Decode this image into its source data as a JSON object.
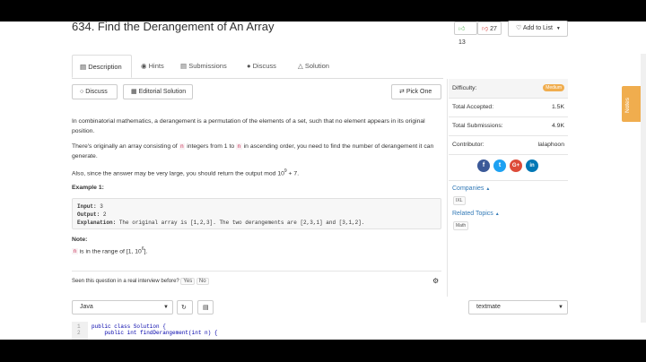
{
  "header": {
    "title": "634. Find the Derangement of An Array",
    "upvotes": "13",
    "downvotes": "27",
    "add_to_list": "Add to List"
  },
  "tabs": [
    {
      "label": "Description"
    },
    {
      "label": "Hints"
    },
    {
      "label": "Submissions"
    },
    {
      "label": "Discuss"
    },
    {
      "label": "Solution"
    }
  ],
  "actions": {
    "discuss": "Discuss",
    "editorial": "Editorial Solution",
    "pick_one": "Pick One"
  },
  "description": {
    "p1": "In combinatorial mathematics, a derangement is a permutation of the elements of a set, such that no element appears in its original position.",
    "p2_a": "There's originally an array consisting of",
    "p2_n1": "n",
    "p2_b": "integers from 1 to",
    "p2_n2": "n",
    "p2_c": "in ascending order, you need to find the number of derangement it can generate.",
    "p3_a": "Also, since the answer may be very large, you should return the output mod 10",
    "p3_exp": "9",
    "p3_b": " + 7.",
    "example_title": "Example 1:",
    "example_input_label": "Input:",
    "example_input": " 3",
    "example_output_label": "Output:",
    "example_output": " 2",
    "example_expl_label": "Explanation:",
    "example_expl": " The original array is [1,2,3]. The two derangements are [2,3,1] and [3,1,2].",
    "note_title": "Note:",
    "note_n": "n",
    "note_text_a": "is in the range of [1, 10",
    "note_exp": "6",
    "note_text_b": "]."
  },
  "interview": {
    "question": "Seen this question in a real interview before?",
    "yes": "Yes",
    "no": "No"
  },
  "sidebar": {
    "difficulty_label": "Difficulty:",
    "difficulty_value": "Medium",
    "accepted_label": "Total Accepted:",
    "accepted_value": "1.5K",
    "submissions_label": "Total Submissions:",
    "submissions_value": "4.9K",
    "contributor_label": "Contributor:",
    "contributor_value": "lalaphoon",
    "companies_label": "Companies",
    "companies_tag": "IXL",
    "topics_label": "Related Topics",
    "topics_tag": "Math"
  },
  "editor": {
    "language": "Java",
    "theme": "textmate",
    "lines": [
      {
        "num": "1",
        "code": "public class Solution {"
      },
      {
        "num": "2",
        "code": "    public int findDerangement(int n) {"
      }
    ]
  },
  "notes_tab": "Notes",
  "colors": {
    "accent": "#337ab7",
    "difficulty_badge": "#f0ad4e",
    "upvote": "#5cb85c",
    "downvote": "#d9534f",
    "facebook": "#3b5998",
    "twitter": "#1da1f2",
    "google": "#dd4b39",
    "linkedin": "#0077b5"
  }
}
